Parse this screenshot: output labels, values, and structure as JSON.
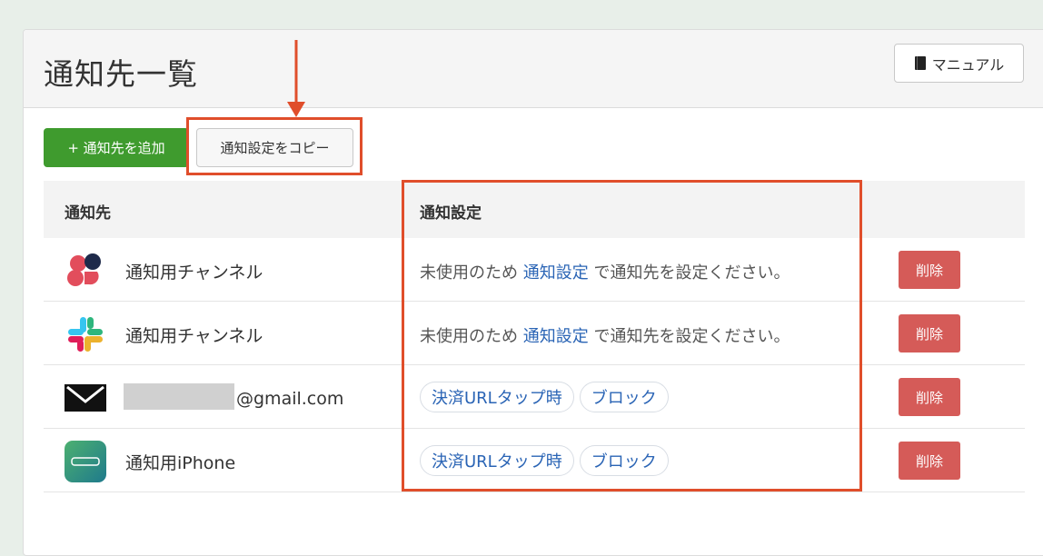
{
  "header": {
    "title": "通知先一覧",
    "manual_label": "マニュアル",
    "manual_icon": "book-icon"
  },
  "toolbar": {
    "add_label": "+ 通知先を追加",
    "copy_label": "通知設定をコピー"
  },
  "table": {
    "columns": [
      "通知先",
      "通知設定"
    ],
    "rows": [
      {
        "icon": "app-icon",
        "name": "通知用チャンネル",
        "setting_prefix": "未使用のため",
        "setting_link": "通知設定",
        "setting_suffix": "で通知先を設定ください。",
        "delete_label": "削除"
      },
      {
        "icon": "slack-icon",
        "name": "通知用チャンネル",
        "setting_prefix": "未使用のため",
        "setting_link": "通知設定",
        "setting_suffix": "で通知先を設定ください。",
        "delete_label": "削除"
      },
      {
        "icon": "mail-icon",
        "name": "@gmail.com",
        "tags": [
          "決済URLタップ時",
          "ブロック"
        ],
        "delete_label": "削除"
      },
      {
        "icon": "phone-app-icon",
        "name": "通知用iPhone",
        "tags": [
          "決済URLタップ時",
          "ブロック"
        ],
        "delete_label": "削除"
      }
    ]
  },
  "colors": {
    "accent_green": "#3f9b2e",
    "danger": "#d55b58",
    "link": "#2a64b5",
    "annotation": "#e04e2b"
  }
}
